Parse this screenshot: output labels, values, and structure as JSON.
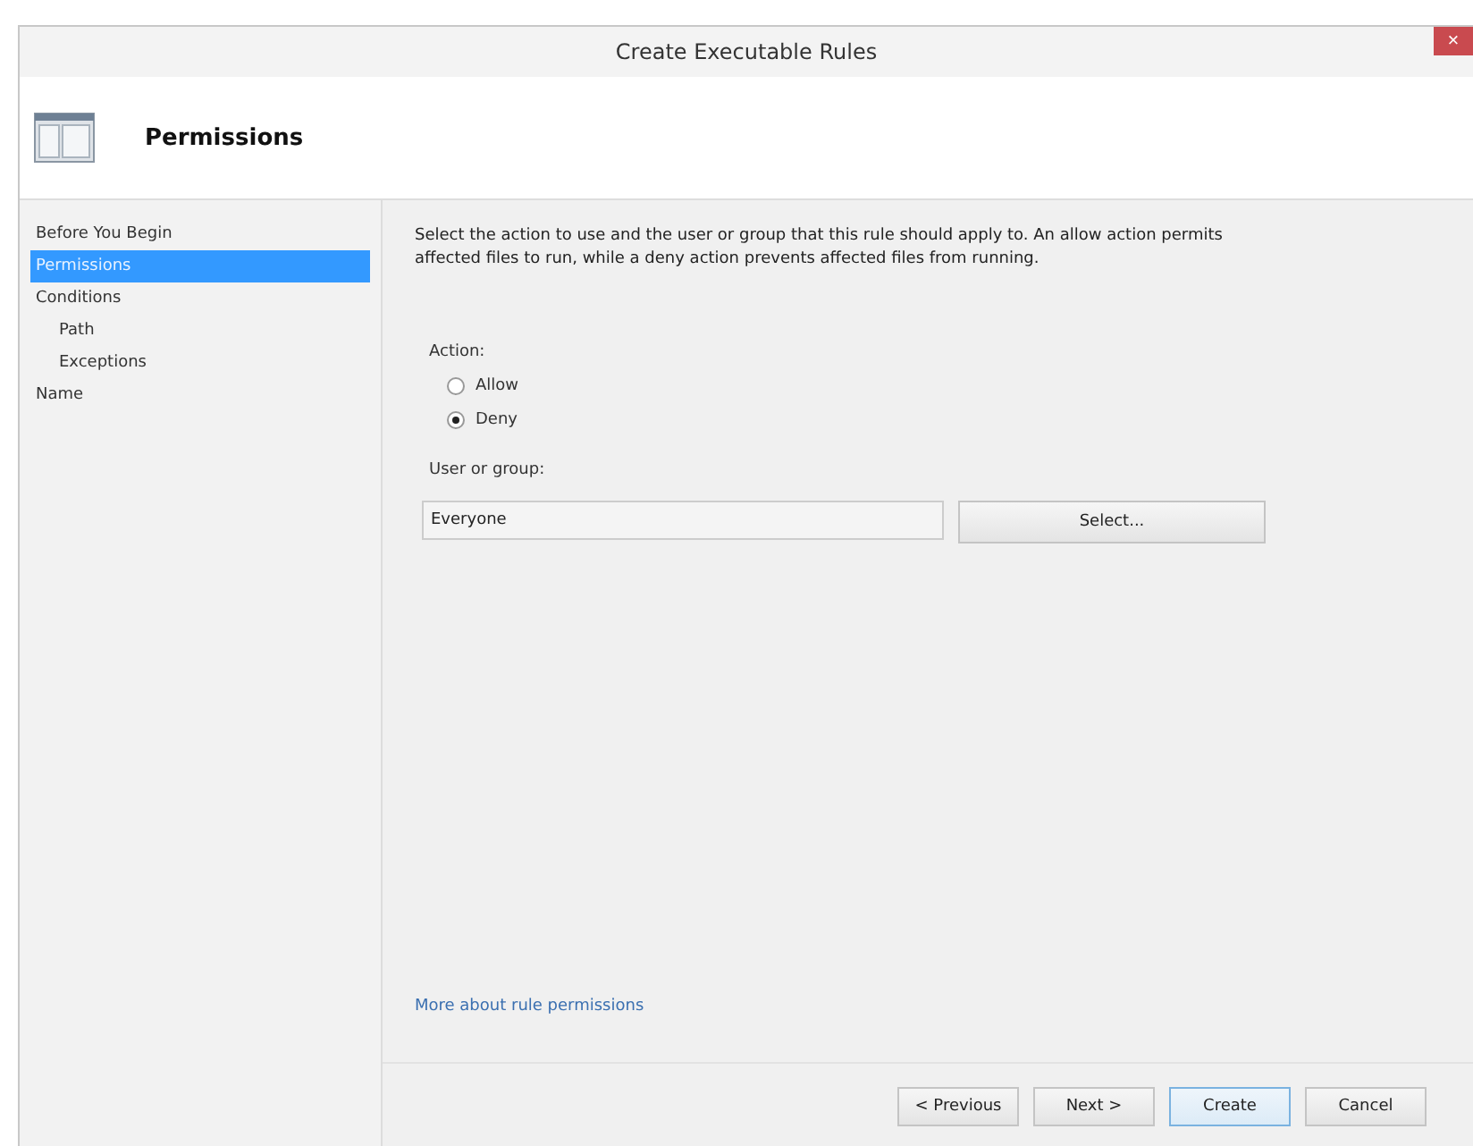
{
  "window": {
    "title": "Create Executable Rules",
    "close": "×"
  },
  "header": {
    "title": "Permissions"
  },
  "steps": [
    {
      "label": "Before You Begin",
      "selected": false
    },
    {
      "label": "Permissions",
      "selected": true
    },
    {
      "label": "Conditions",
      "selected": false,
      "children": [
        {
          "label": "Path",
          "selected": false
        },
        {
          "label": "Exceptions",
          "selected": false
        }
      ]
    },
    {
      "label": "Name",
      "selected": false
    }
  ],
  "description": "Select the action to use and the user or group that this rule should apply to. An allow action permits affected files to run, while a deny action prevents affected files from running.",
  "action": {
    "label": "Action:",
    "options": [
      {
        "label": "Allow",
        "selected": false
      },
      {
        "label": "Deny",
        "selected": true
      }
    ]
  },
  "user_group": {
    "label": "User or group:",
    "value": "Everyone",
    "button": "Select..."
  },
  "link": "More about rule permissions",
  "buttons": [
    {
      "label": "< Previous",
      "kind": "normal"
    },
    {
      "label": "Next >",
      "kind": "normal"
    },
    {
      "label": "Create",
      "kind": "default"
    },
    {
      "label": "Cancel",
      "kind": "normal"
    }
  ]
}
